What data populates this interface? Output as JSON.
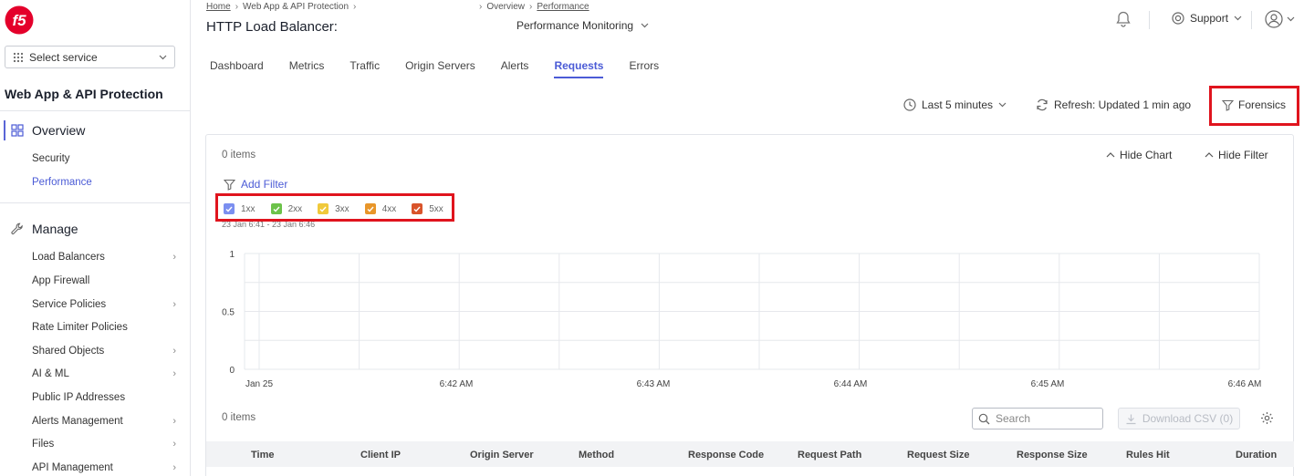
{
  "sidebar": {
    "service_select_label": "Select service",
    "workspace_title": "Web App & API Protection",
    "overview": {
      "label": "Overview",
      "items": [
        {
          "label": "Security"
        },
        {
          "label": "Performance"
        }
      ]
    },
    "manage": {
      "label": "Manage",
      "items": [
        {
          "label": "Load Balancers"
        },
        {
          "label": "App Firewall"
        },
        {
          "label": "Service Policies"
        },
        {
          "label": "Rate Limiter Policies"
        },
        {
          "label": "Shared Objects"
        },
        {
          "label": "AI & ML"
        },
        {
          "label": "Public IP Addresses"
        },
        {
          "label": "Alerts Management"
        },
        {
          "label": "Files"
        },
        {
          "label": "API Management"
        }
      ]
    }
  },
  "header": {
    "breadcrumb": [
      "Home",
      "Web App & API Protection"
    ],
    "breadcrumb2": [
      "Overview",
      "Performance"
    ],
    "title": "HTTP Load Balancer:",
    "view_dropdown": "Performance Monitoring",
    "support_label": "Support"
  },
  "tabs": [
    "Dashboard",
    "Metrics",
    "Traffic",
    "Origin Servers",
    "Alerts",
    "Requests",
    "Errors"
  ],
  "toolbar": {
    "time_range": "Last 5 minutes",
    "refresh": "Refresh: Updated 1 min ago",
    "forensics": "Forensics"
  },
  "panel": {
    "items_count": "0 items",
    "hide_chart": "Hide Chart",
    "hide_filter": "Hide Filter",
    "add_filter": "Add Filter",
    "legend": [
      {
        "label": "1xx",
        "color": "#7b8ff0"
      },
      {
        "label": "2xx",
        "color": "#6cc24a"
      },
      {
        "label": "3xx",
        "color": "#f0c93b"
      },
      {
        "label": "4xx",
        "color": "#e8962a"
      },
      {
        "label": "5xx",
        "color": "#d9542b"
      }
    ],
    "date_range": "23 Jan 6:41 - 23 Jan 6:46"
  },
  "chart_data": {
    "type": "line",
    "y_ticks": [
      "1",
      "0.5",
      "0"
    ],
    "x_ticks": [
      "Jan 25",
      "6:42 AM",
      "6:43 AM",
      "6:44 AM",
      "6:45 AM",
      "6:46 AM"
    ],
    "ylim": [
      0,
      1
    ],
    "series": []
  },
  "table": {
    "items_count": "0 items",
    "search_placeholder": "Search",
    "download_label": "Download CSV (0)",
    "columns": [
      "Time",
      "Client IP",
      "Origin Server",
      "Method",
      "Response Code",
      "Request Path",
      "Request Size",
      "Response Size",
      "Rules Hit",
      "Duration"
    ]
  }
}
